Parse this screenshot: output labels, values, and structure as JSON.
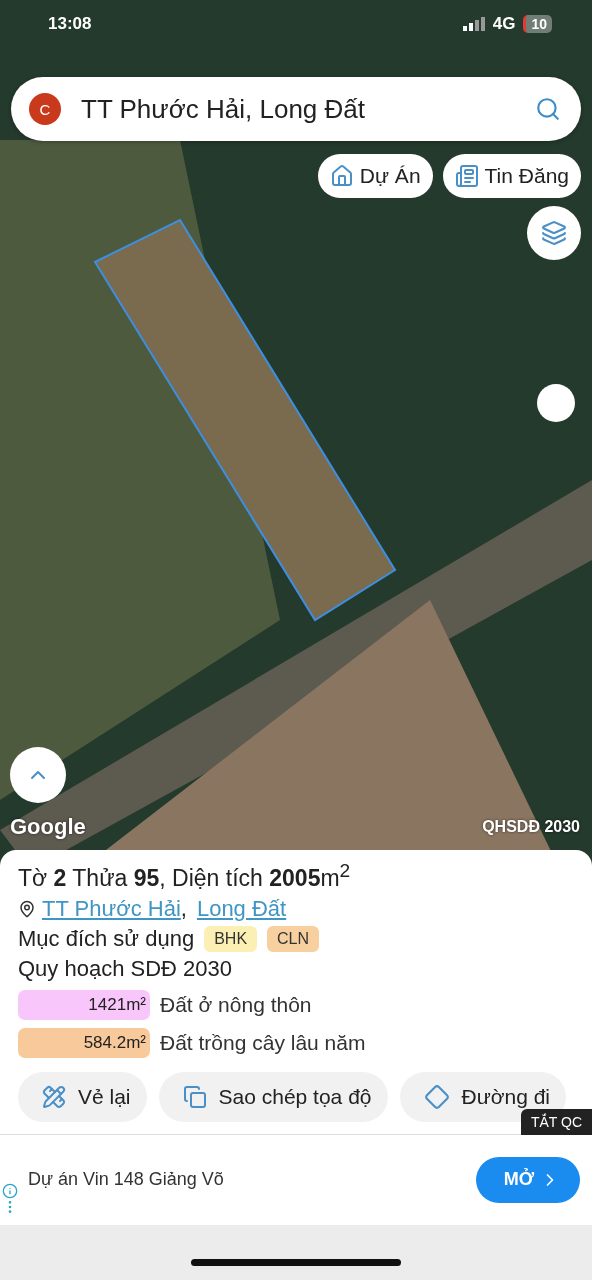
{
  "status_bar": {
    "time": "13:08",
    "network": "4G",
    "battery": "10"
  },
  "search": {
    "avatar": "C",
    "value": "TT Phước Hải, Long Đất"
  },
  "map_chips": [
    {
      "kind": "project",
      "label": "Dự Án"
    },
    {
      "kind": "listing",
      "label": "Tin Đăng"
    }
  ],
  "map": {
    "attribution": "Google",
    "layer_label": "QHSDĐ 2030"
  },
  "parcel": {
    "title": "Tờ **2** Thửa **95**, Diện tích **2005**m$^{2}$",
    "location": [
      {
        "label": "TT Phước Hải"
      },
      {
        "label": "Long Đất"
      }
    ],
    "location_separator": ",",
    "usage_label": "Mục đích sử dụng",
    "usage_tags": [
      {
        "label": "BHK",
        "color": "#fcefb4"
      },
      {
        "label": "CLN",
        "color": "#f8cf9f"
      }
    ],
    "plan_label": "Quy hoạch SDĐ 2030",
    "plan_items": [
      {
        "area": "1421m²",
        "name": "Đất ở nông thôn",
        "color": "#f8c6fa"
      },
      {
        "area": "584.2m²",
        "name": "Đất trồng cây lâu năm",
        "color": "#f8c99b"
      }
    ]
  },
  "actions": [
    {
      "kind": "redraw",
      "label": "Vẻ lại"
    },
    {
      "kind": "copy",
      "label": "Sao chép tọa độ"
    },
    {
      "kind": "directions",
      "label": "Đường đi"
    }
  ],
  "ad": {
    "close_label": "TẮT QC",
    "text": "Dự án Vin 148 Giảng Võ",
    "button": "MỞ"
  }
}
